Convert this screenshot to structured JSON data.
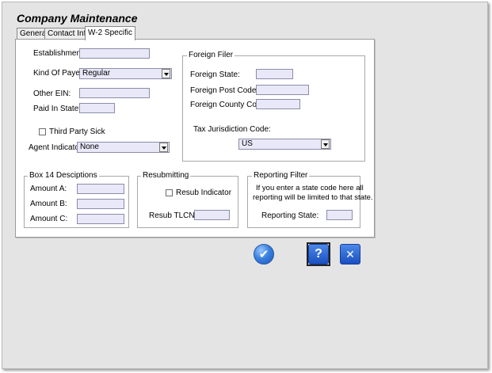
{
  "window": {
    "title": "Company Maintenance"
  },
  "tabs": [
    {
      "label": "General"
    },
    {
      "label": "Contact Info"
    },
    {
      "label": "W-2 Specific",
      "active": true
    }
  ],
  "fields": {
    "establishment": {
      "label": "Establishment:",
      "value": ""
    },
    "kind_of_payer": {
      "label": "Kind Of Payer:",
      "value": "Regular"
    },
    "other_ein": {
      "label": "Other EIN:",
      "value": ""
    },
    "paid_in_state": {
      "label": "Paid In State:",
      "value": ""
    },
    "third_party_sick": {
      "label": "Third Party Sick",
      "checked": false
    },
    "agent_indicator": {
      "label": "Agent Indicator:",
      "value": "None"
    }
  },
  "foreign_filer": {
    "legend": "Foreign Filer",
    "foreign_state": {
      "label": "Foreign State:",
      "value": ""
    },
    "foreign_post_code": {
      "label": "Foreign Post Code:",
      "value": ""
    },
    "foreign_county_code": {
      "label": "Foreign County Code:",
      "value": ""
    },
    "tax_jurisdiction": {
      "label": "Tax Jurisdiction Code:",
      "value": "US"
    }
  },
  "box14": {
    "legend": "Box 14 Desciptions",
    "amount_a": {
      "label": "Amount A:",
      "value": ""
    },
    "amount_b": {
      "label": "Amount B:",
      "value": ""
    },
    "amount_c": {
      "label": "Amount C:",
      "value": ""
    }
  },
  "resubmitting": {
    "legend": "Resubmitting",
    "resub_indicator": {
      "label": "Resub Indicator",
      "checked": false
    },
    "resub_tlcn": {
      "label": "Resub TLCN:",
      "value": ""
    }
  },
  "reporting_filter": {
    "legend": "Reporting Filter",
    "note_line1": "If you enter a state code here all",
    "note_line2": "reporting will be limited to that state.",
    "reporting_state": {
      "label": "Reporting State:",
      "value": ""
    }
  },
  "buttons": {
    "ok_glyph": "✔",
    "help_glyph": "?",
    "close_glyph": "✕"
  },
  "colors": {
    "field_bg": "#e8e8f8",
    "window_bg": "#e4e4e4",
    "button_blue": "#1b4fbf"
  }
}
